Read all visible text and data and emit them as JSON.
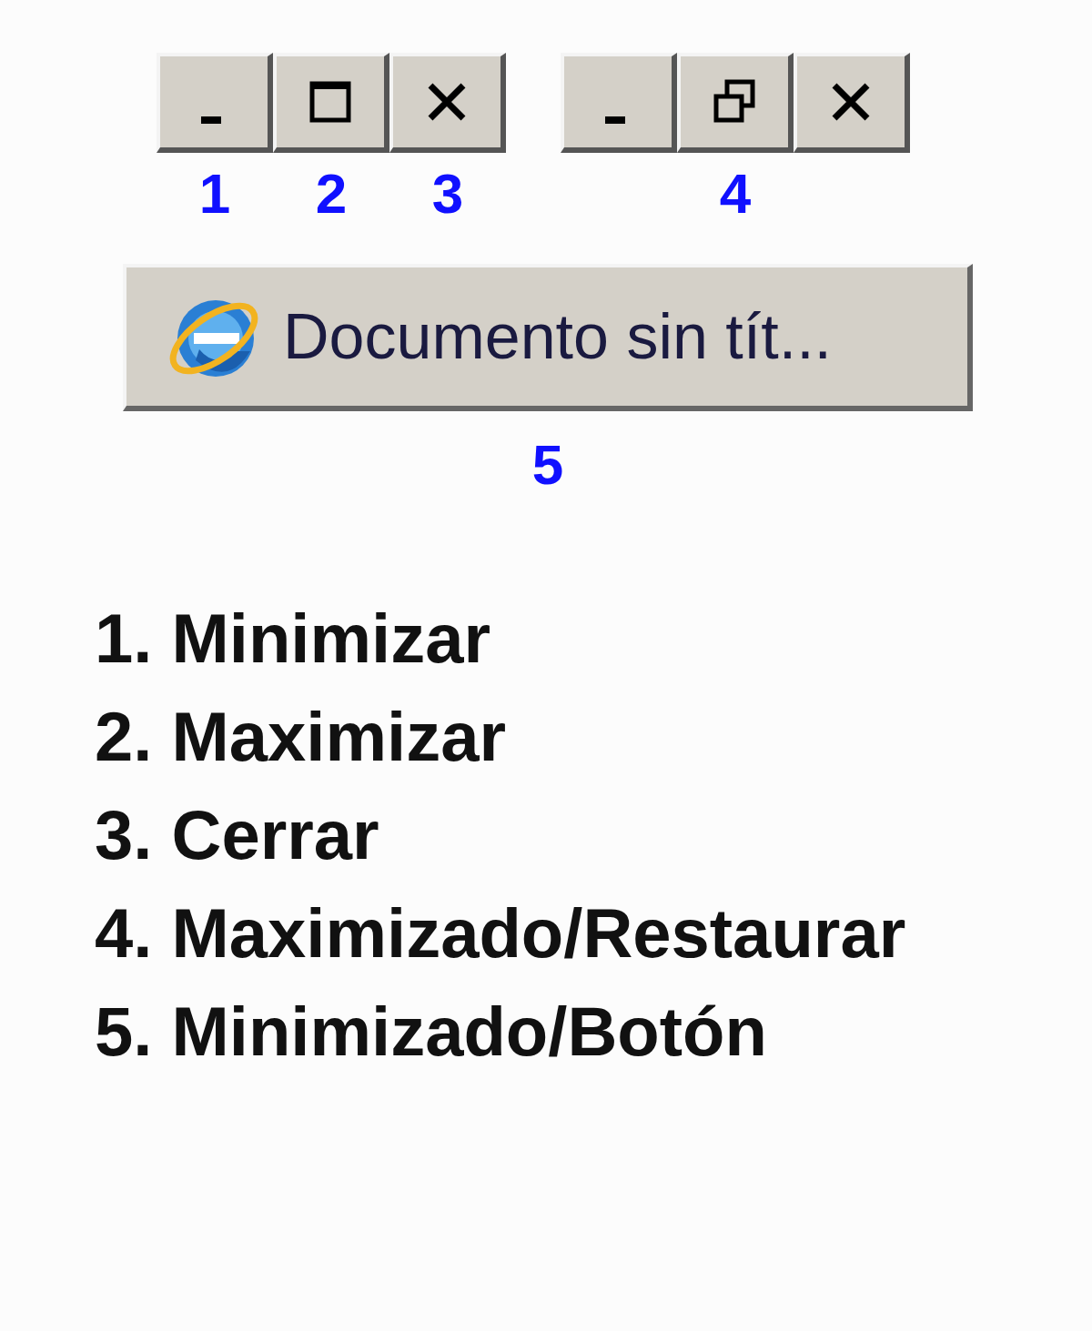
{
  "button_groups": [
    {
      "buttons": [
        {
          "kind": "minimize",
          "label": "1"
        },
        {
          "kind": "maximize",
          "label": "2"
        },
        {
          "kind": "close",
          "label": "3"
        }
      ]
    },
    {
      "buttons": [
        {
          "kind": "minimize"
        },
        {
          "kind": "restore",
          "label": "4"
        },
        {
          "kind": "close"
        }
      ]
    }
  ],
  "taskbar_button": {
    "text": "Documento sin tít...",
    "label": "5"
  },
  "legend": [
    "1. Minimizar",
    "2. Maximizar",
    "3. Cerrar",
    "4. Maximizado/Restaurar",
    "5. Minimizado/Botón"
  ]
}
